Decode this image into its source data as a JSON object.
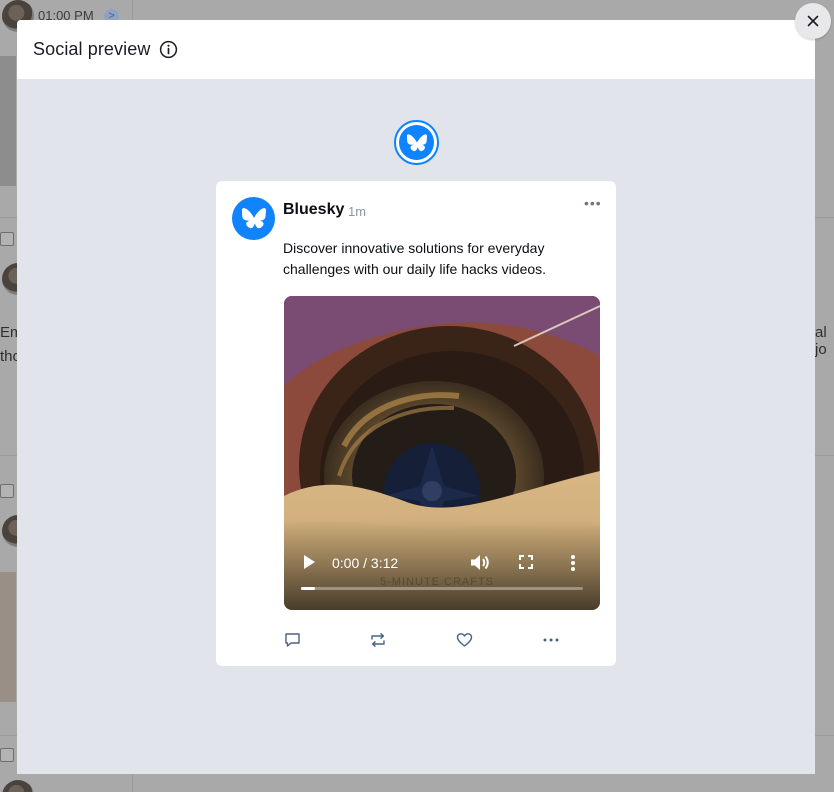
{
  "background": {
    "time_text": "01:00 PM",
    "time_badge": ">",
    "left_text_1": "Em",
    "left_text_2": "tho",
    "right_text": "al jo"
  },
  "modal": {
    "title": "Social preview",
    "info_icon": "info-icon",
    "close_icon": "close-icon"
  },
  "network": {
    "name": "Bluesky",
    "icon": "butterfly-icon",
    "accent_color": "#1083fe"
  },
  "post": {
    "author": "Bluesky",
    "time": "1m",
    "more_icon": "more-horizontal-icon",
    "text": "Discover innovative solutions for everyday challenges with our daily life hacks videos.",
    "video": {
      "current_time": "0:00",
      "duration": "3:12",
      "time_display": "0:00 / 3:12",
      "progress": 0.05,
      "watermark": "5-MINUTE CRAFTS"
    },
    "actions": [
      {
        "name": "reply",
        "icon": "comment-icon"
      },
      {
        "name": "repost",
        "icon": "repost-icon"
      },
      {
        "name": "like",
        "icon": "heart-icon"
      },
      {
        "name": "more",
        "icon": "more-horizontal-icon"
      }
    ]
  }
}
